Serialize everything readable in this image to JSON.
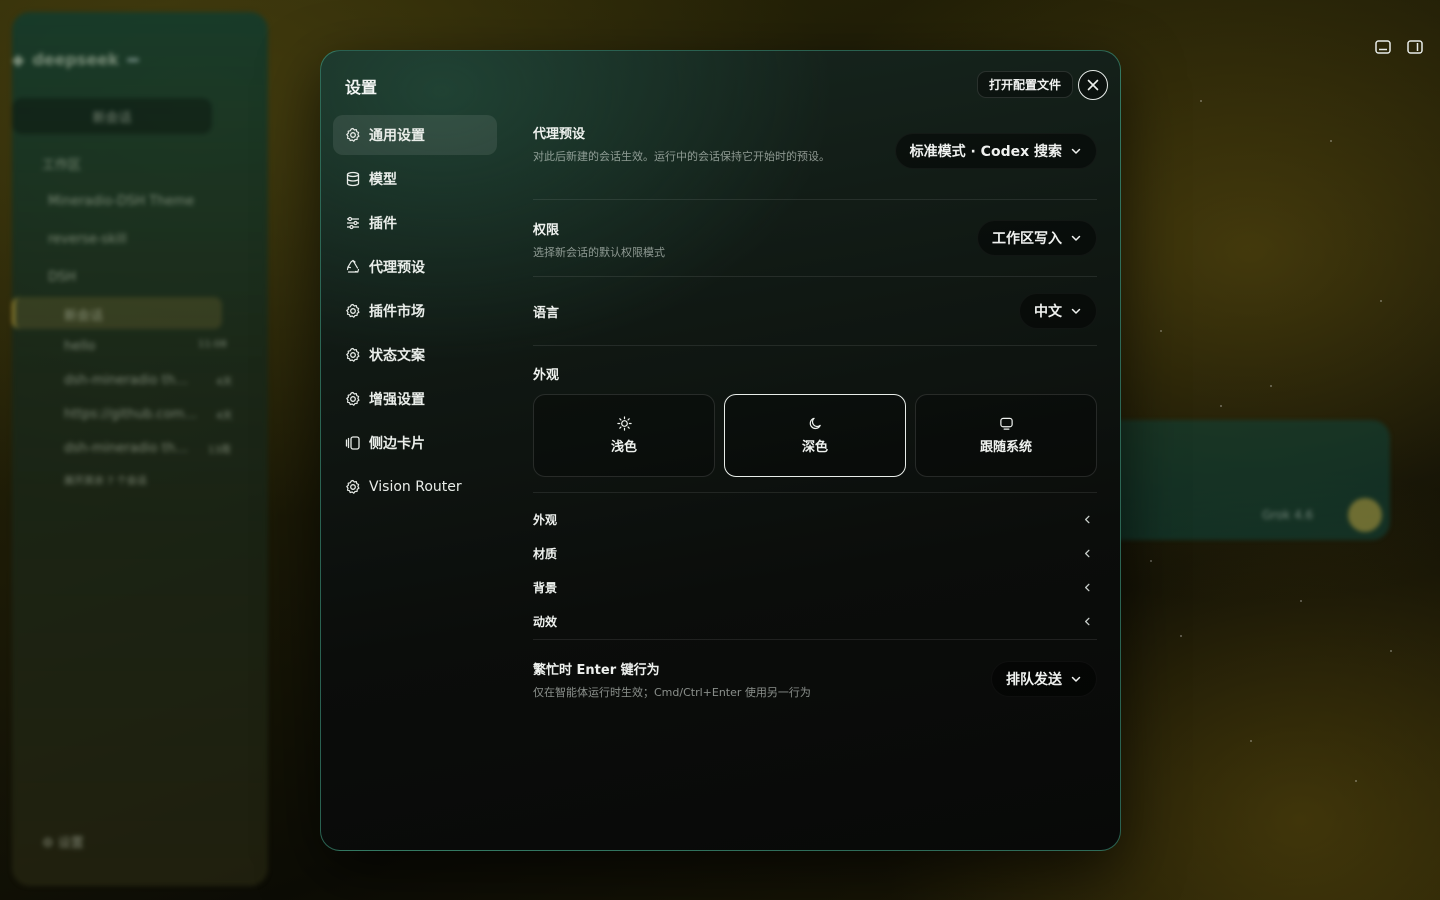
{
  "background": {
    "app_logo": "deepseek",
    "app_badge": "",
    "new_chat": "新会话",
    "workspace_label": "工作区",
    "projects": [
      "Mineradio-DSH Theme",
      "reverse-skill",
      "DSH"
    ],
    "chats": [
      {
        "title": "新会话",
        "time": ""
      },
      {
        "title": "hello",
        "time": "11:08"
      },
      {
        "title": "dsh-mineradio th…",
        "time": "4天"
      },
      {
        "title": "https://github.com…",
        "time": "4天"
      },
      {
        "title": "dsh-mineradio th…",
        "time": "13周"
      }
    ],
    "more_label": "展开其余 7 个会话",
    "settings_label": "设置",
    "model_label": "Grok 4.6"
  },
  "modal": {
    "title": "设置",
    "open_config_label": "打开配置文件",
    "close_label": "关闭"
  },
  "nav": {
    "items": [
      {
        "label": "通用设置",
        "icon": "gear-icon",
        "active": true
      },
      {
        "label": "模型",
        "icon": "database-icon"
      },
      {
        "label": "插件",
        "icon": "sliders-icon"
      },
      {
        "label": "代理预设",
        "icon": "recycle-icon"
      },
      {
        "label": "插件市场",
        "icon": "gear-icon"
      },
      {
        "label": "状态文案",
        "icon": "gear-icon"
      },
      {
        "label": "增强设置",
        "icon": "gear-icon"
      },
      {
        "label": "侧边卡片",
        "icon": "cards-icon"
      },
      {
        "label": "Vision Router",
        "icon": "gear-icon"
      }
    ]
  },
  "settings": {
    "agent_preset": {
      "title": "代理预设",
      "desc": "对此后新建的会话生效。运行中的会话保持它开始时的预设。",
      "value": "标准模式 · Codex 搜索"
    },
    "permission": {
      "title": "权限",
      "desc": "选择新会话的默认权限模式",
      "value": "工作区写入"
    },
    "language": {
      "title": "语言",
      "value": "中文"
    },
    "appearance": {
      "title": "外观",
      "options": [
        {
          "label": "浅色",
          "icon": "sun-icon"
        },
        {
          "label": "深色",
          "icon": "moon-icon",
          "selected": true
        },
        {
          "label": "跟随系统",
          "icon": "monitor-icon"
        }
      ]
    },
    "sections": [
      "外观",
      "材质",
      "背景",
      "动效"
    ],
    "busy_enter": {
      "title": "繁忙时 Enter 键行为",
      "desc": "仅在智能体运行时生效；Cmd/Ctrl+Enter 使用另一行为",
      "value": "排队发送"
    }
  }
}
